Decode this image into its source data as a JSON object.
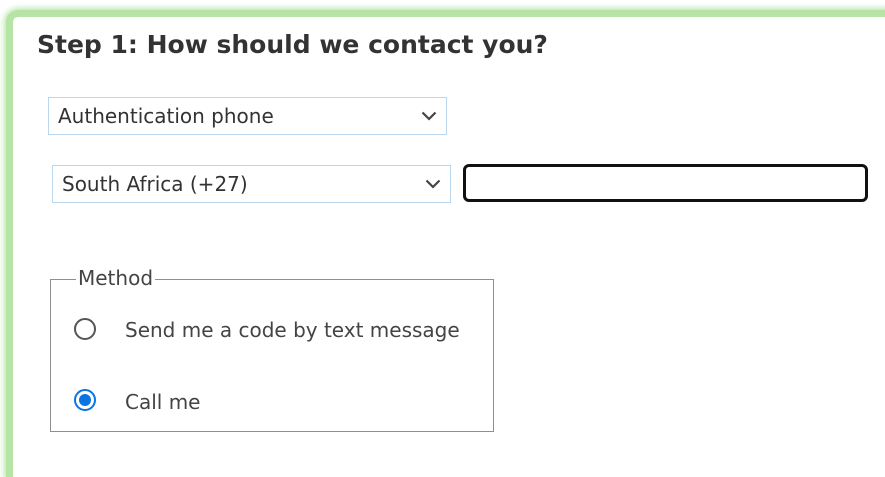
{
  "step": {
    "title": "Step 1: How should we contact you?"
  },
  "contact_method_select": {
    "selected": "Authentication phone"
  },
  "country_select": {
    "selected": "South Africa (+27)"
  },
  "phone_input": {
    "value": ""
  },
  "method_group": {
    "legend": "Method",
    "options": [
      {
        "label": "Send me a code by text message",
        "checked": false
      },
      {
        "label": "Call me",
        "checked": true
      }
    ]
  },
  "colors": {
    "frame_border": "#b5e4a5",
    "accent": "#0a74e3",
    "select_border": "#b9d7ef"
  },
  "icons": {
    "dropdown": "chevron-down-icon"
  }
}
